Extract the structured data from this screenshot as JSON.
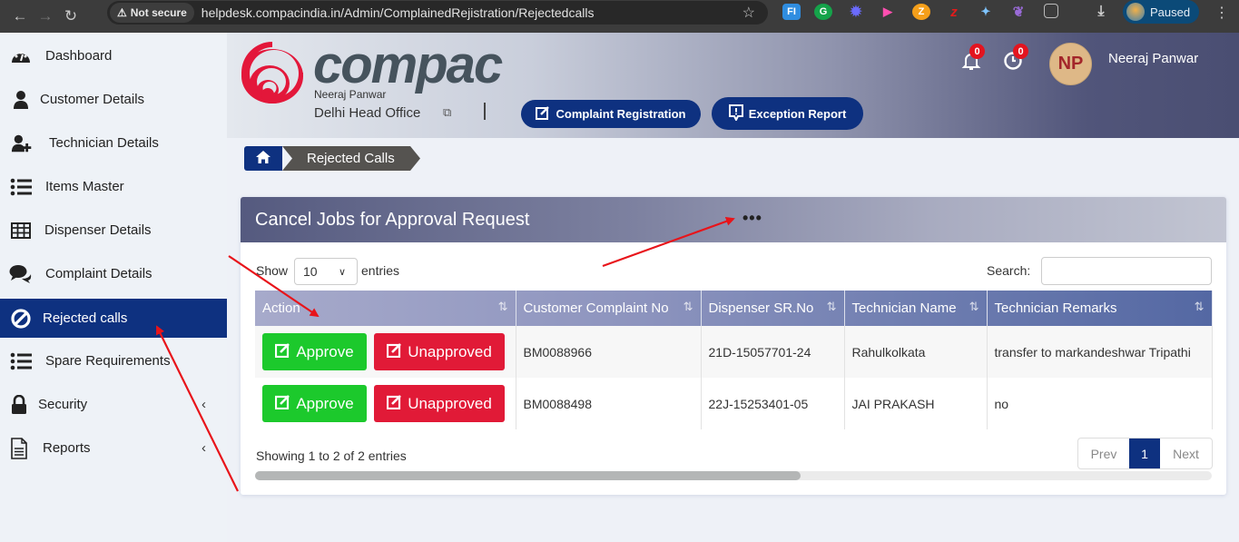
{
  "browser": {
    "security_label": "Not secure",
    "url": "helpdesk.compacindia.in/Admin/ComplainedRejistration/Rejectedcalls",
    "profile_status": "Paused",
    "extensions": [
      "fi-extension-icon",
      "grammarly-icon",
      "sparkle-extension-icon",
      "video-extension-icon",
      "zoho-extension-icon",
      "zomato-extension-icon",
      "bird-extension-icon",
      "feather-extension-icon",
      "puzzle-icon"
    ]
  },
  "sidebar": {
    "items": [
      {
        "label": "Dashboard",
        "icon": "dashboard-gauge-icon"
      },
      {
        "label": "Customer Details",
        "icon": "user-icon"
      },
      {
        "label": "Technician Details",
        "icon": "user-plus-icon"
      },
      {
        "label": "Items Master",
        "icon": "list-icon"
      },
      {
        "label": "Dispenser Details",
        "icon": "table-icon"
      },
      {
        "label": "Complaint Details",
        "icon": "comments-icon"
      },
      {
        "label": "Rejected calls",
        "icon": "ban-icon",
        "active": true
      },
      {
        "label": "Spare Requirements",
        "icon": "list-icon"
      },
      {
        "label": "Security",
        "icon": "lock-icon",
        "expandable": true
      },
      {
        "label": "Reports",
        "icon": "document-icon",
        "expandable": true
      }
    ]
  },
  "header": {
    "logo_text": "compac",
    "user_small": "Neeraj Panwar",
    "office": "Delhi Head Office",
    "buttons": {
      "complaint_registration": "Complaint Registration",
      "exception_report": "Exception Report"
    },
    "notifications_count": "0",
    "history_count": "0",
    "avatar_initials": "NP",
    "user_name": "Neeraj Panwar"
  },
  "breadcrumb": {
    "current": "Rejected Calls"
  },
  "card": {
    "title": "Cancel Jobs for Approval Request",
    "show_label": "Show",
    "page_length": "10",
    "entries_label": "entries",
    "search_label": "Search:",
    "search_value": "",
    "columns": [
      "Action",
      "Customer Complaint No",
      "Dispenser SR.No",
      "Technician Name",
      "Technician Remarks"
    ],
    "approve_label": "Approve",
    "unapprove_label": "Unapproved",
    "rows": [
      {
        "complaint_no": "BM0088966",
        "dispenser_sr": "21D-15057701-24",
        "technician": "Rahulkolkata",
        "remarks": "transfer to markandeshwar Tripathi"
      },
      {
        "complaint_no": "BM0088498",
        "dispenser_sr": "22J-15253401-05",
        "technician": "JAI PRAKASH",
        "remarks": "no"
      }
    ],
    "info": "Showing 1 to 2 of 2 entries",
    "pager": {
      "prev": "Prev",
      "current": "1",
      "next": "Next"
    },
    "horizontal_scroll_fraction": 0.57
  },
  "colors": {
    "primary": "#0e3180",
    "approve": "#1cc92c",
    "unapprove": "#e11a37",
    "badge": "#e3141f",
    "logo_red": "#e3173a",
    "annotation_arrow": "#e8141a"
  }
}
